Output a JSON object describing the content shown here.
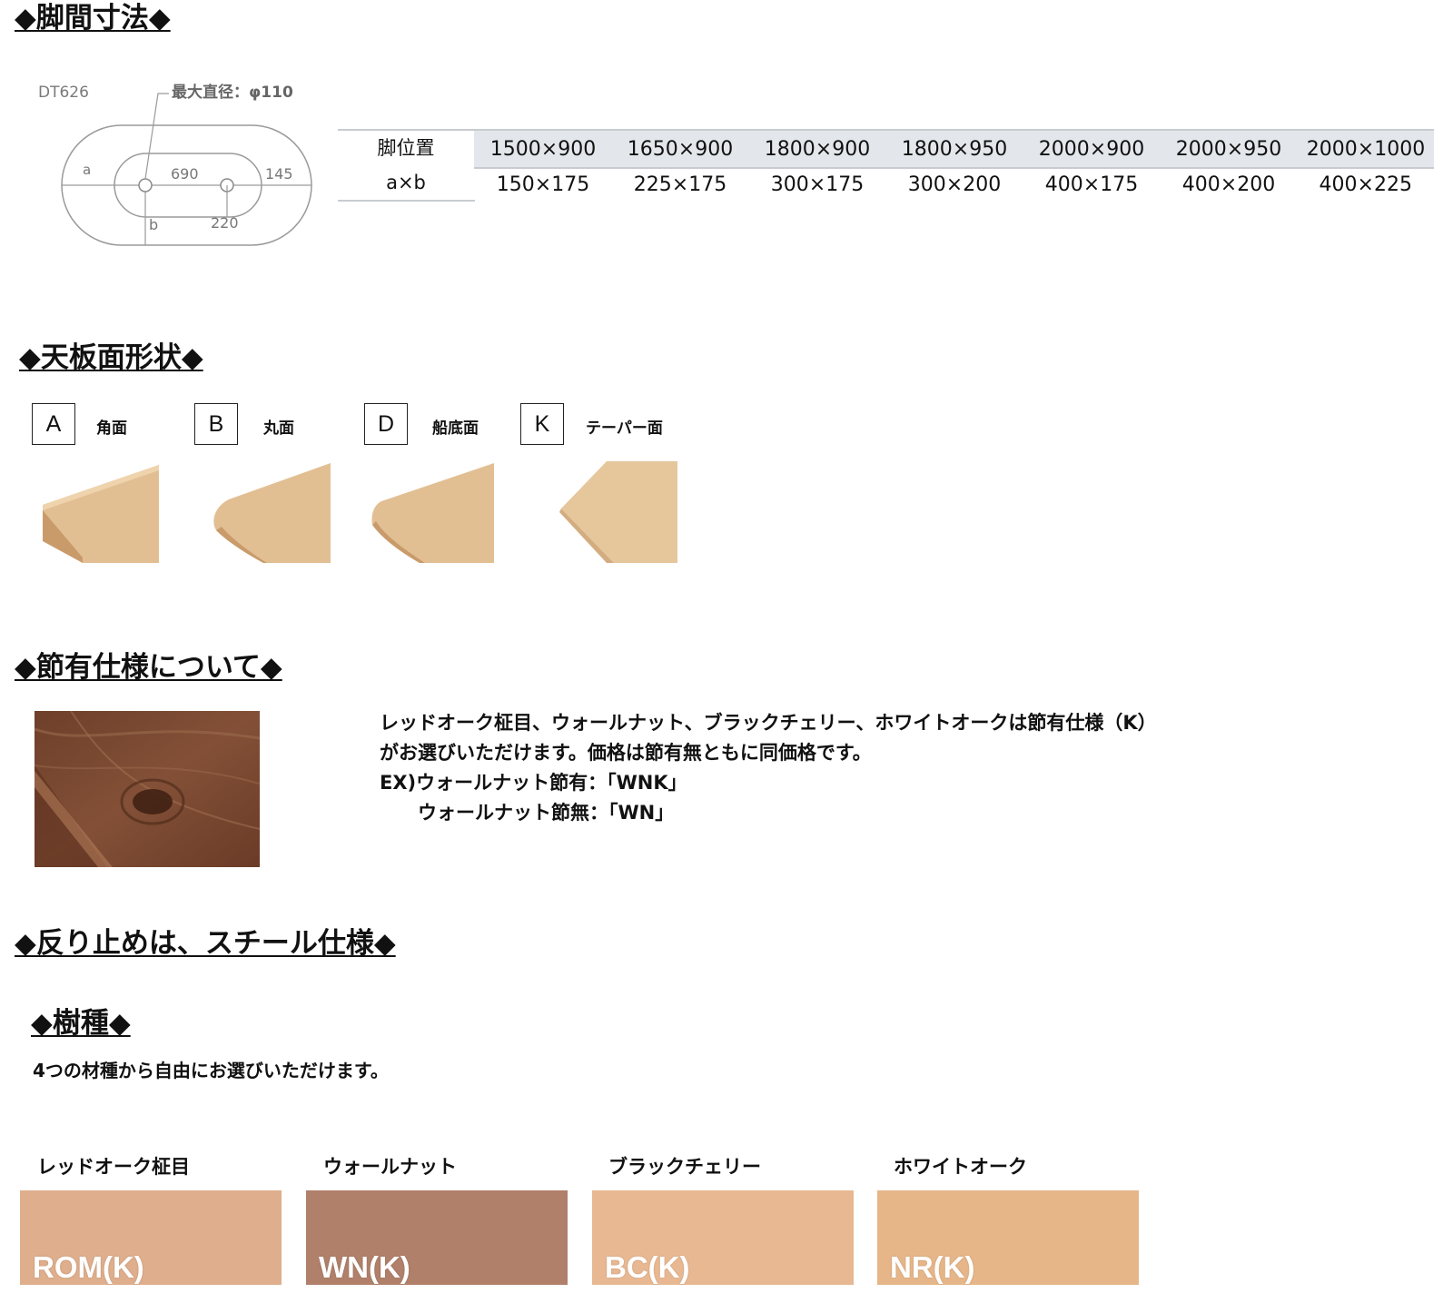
{
  "sections": {
    "leg_span": "◆脚間寸法◆",
    "top_shape": "◆天板面形状◆",
    "knot_spec": "◆節有仕様について◆",
    "warp": "◆反り止めは、スチール仕様◆",
    "species": "◆樹種◆"
  },
  "diagram": {
    "model": "DT626",
    "max_diameter": "最大直径：φ110",
    "label_a": "a",
    "label_b": "b",
    "dim_690": "690",
    "dim_145": "145",
    "dim_220": "220"
  },
  "table": {
    "row_header_line1": "脚位置",
    "row_header_line2": "a×b",
    "sizes": [
      "1500×900",
      "1650×900",
      "1800×900",
      "1800×950",
      "2000×900",
      "2000×950",
      "2000×1000"
    ],
    "positions": [
      "150×175",
      "225×175",
      "300×175",
      "300×200",
      "400×175",
      "400×200",
      "400×225"
    ]
  },
  "shapes": [
    {
      "code": "A",
      "label": "角面",
      "icon": "square-edge-wood"
    },
    {
      "code": "B",
      "label": "丸面",
      "icon": "round-edge-wood"
    },
    {
      "code": "D",
      "label": "船底面",
      "icon": "boat-bottom-edge-wood"
    },
    {
      "code": "K",
      "label": "テーパー面",
      "icon": "taper-edge-wood"
    }
  ],
  "knot": {
    "line1": "レッドオーク柾目、ウォールナット、ブラックチェリー、ホワイトオークは節有仕様（K）",
    "line2": "がお選びいただけます。価格は節有無ともに同価格です。",
    "line3": "EX)ウォールナット節有：「WNK」",
    "line4": "ウォールナット節無：「WN」",
    "image": "walnut-knot-sample"
  },
  "species_desc": "4つの材種から自由にお選びいただけます。",
  "species": [
    {
      "name": "レッドオーク柾目",
      "code": "ROM(K)",
      "color": "#dfae8c"
    },
    {
      "name": "ウォールナット",
      "code": "WN(K)",
      "color": "#b0806a"
    },
    {
      "name": "ブラックチェリー",
      "code": "BC(K)",
      "color": "#e8b892"
    },
    {
      "name": "ホワイトオーク",
      "code": "NR(K)",
      "color": "#e6b689"
    }
  ]
}
